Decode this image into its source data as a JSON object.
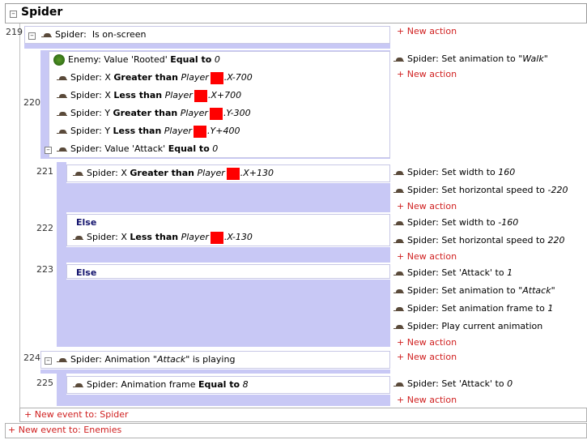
{
  "group": {
    "title": "Spider",
    "collapse": "–"
  },
  "new_action": "+ New action",
  "events": {
    "e219": {
      "num": "219",
      "cond": {
        "obj": "Spider:",
        "text": "Is on-screen"
      }
    },
    "e220": {
      "num": "220",
      "conds": [
        {
          "obj": "Enemy:",
          "p1": "Value 'Rooted'",
          "op": "Equal to",
          "val": "0"
        },
        {
          "obj": "Spider:",
          "p1": "X",
          "op": "Greater than",
          "player": "Player",
          "val": ".X-700"
        },
        {
          "obj": "Spider:",
          "p1": "X",
          "op": "Less than",
          "player": "Player",
          "val": ".X+700"
        },
        {
          "obj": "Spider:",
          "p1": "Y",
          "op": "Greater than",
          "player": "Player",
          "val": ".Y-300"
        },
        {
          "obj": "Spider:",
          "p1": "Y",
          "op": "Less than",
          "player": "Player",
          "val": ".Y+400"
        },
        {
          "obj": "Spider:",
          "p1": "Value 'Attack'",
          "op": "Equal to",
          "val": "0"
        }
      ],
      "actions": [
        {
          "obj": "Spider:",
          "text": "Set animation to",
          "val": "\"Walk\""
        }
      ]
    },
    "e221": {
      "num": "221",
      "cond": {
        "obj": "Spider:",
        "p1": "X",
        "op": "Greater than",
        "player": "Player",
        "val": ".X+130"
      },
      "actions": [
        {
          "obj": "Spider:",
          "text": "Set width to",
          "val": "160"
        },
        {
          "obj": "Spider:",
          "text": "Set horizontal speed to",
          "val": "-220"
        }
      ]
    },
    "e222": {
      "num": "222",
      "else": "Else",
      "cond": {
        "obj": "Spider:",
        "p1": "X",
        "op": "Less than",
        "player": "Player",
        "val": ".X-130"
      },
      "actions": [
        {
          "obj": "Spider:",
          "text": "Set width to",
          "val": "-160"
        },
        {
          "obj": "Spider:",
          "text": "Set horizontal speed to",
          "val": "220"
        }
      ]
    },
    "e223": {
      "num": "223",
      "else": "Else",
      "actions": [
        {
          "obj": "Spider:",
          "text": "Set 'Attack' to",
          "val": "1"
        },
        {
          "obj": "Spider:",
          "text": "Set animation to",
          "val": "\"Attack\""
        },
        {
          "obj": "Spider:",
          "text": "Set animation frame to",
          "val": "1"
        },
        {
          "obj": "Spider:",
          "text": "Play current animation",
          "val": ""
        }
      ]
    },
    "e224": {
      "num": "224",
      "cond": {
        "obj": "Spider:",
        "text": "Animation",
        "val": "\"Attack\"",
        "tail": "is playing"
      }
    },
    "e225": {
      "num": "225",
      "cond": {
        "obj": "Spider:",
        "p1": "Animation frame",
        "op": "Equal to",
        "val": "8"
      },
      "actions": [
        {
          "obj": "Spider:",
          "text": "Set 'Attack' to",
          "val": "0"
        }
      ]
    }
  },
  "new_event_spider": "+ New event to: Spider",
  "new_event_enemies": "+ New event to: Enemies",
  "colors": {
    "new_link": "#d02020",
    "sub_bg": "#c8c8f5",
    "swatch": "#ff0000"
  }
}
